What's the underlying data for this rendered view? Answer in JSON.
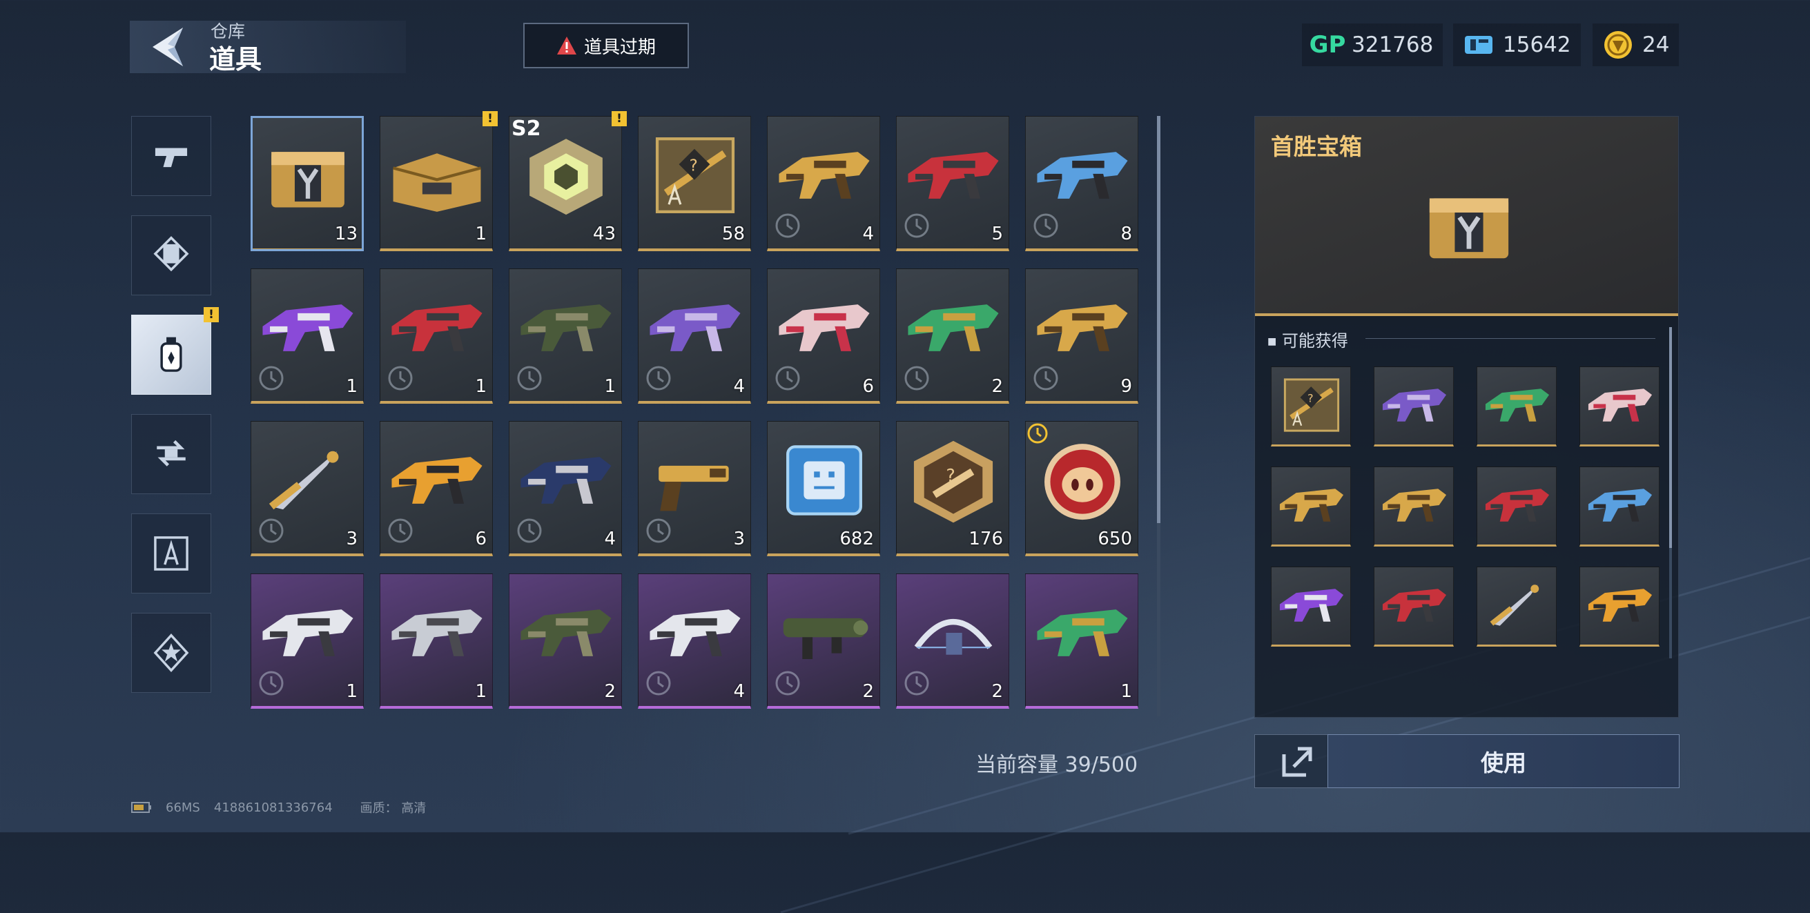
{
  "header": {
    "breadcrumb": "仓库",
    "title": "道具",
    "expire_button": "道具过期"
  },
  "currencies": [
    {
      "icon": "gp-icon",
      "label": "GP",
      "value": "321768",
      "color": "#36d9a0"
    },
    {
      "icon": "ticket-icon",
      "value": "15642",
      "color": "#58b6f0"
    },
    {
      "icon": "gold-coin-icon",
      "value": "24",
      "color": "#f2c232"
    }
  ],
  "categories": [
    {
      "name": "weapons",
      "icon": "pistol-icon",
      "active": false
    },
    {
      "name": "cards",
      "icon": "card-icon",
      "active": false
    },
    {
      "name": "items",
      "icon": "spray-can-icon",
      "active": true,
      "alert": "!"
    },
    {
      "name": "exchange",
      "icon": "exchange-icon",
      "active": false
    },
    {
      "name": "blueprints",
      "icon": "compass-icon",
      "active": false
    },
    {
      "name": "badges",
      "icon": "star-badge-icon",
      "active": false
    }
  ],
  "inventory": [
    {
      "art": "gold-chest",
      "count": "13",
      "selected": true
    },
    {
      "art": "gold-case",
      "count": "1",
      "alert": "!"
    },
    {
      "art": "hex-core",
      "count": "43",
      "season": "S2",
      "alert": "!"
    },
    {
      "art": "blueprint-card",
      "count": "58"
    },
    {
      "art": "rifle-gold-black",
      "count": "4",
      "timed": true
    },
    {
      "art": "rifle-red",
      "count": "5",
      "timed": true
    },
    {
      "art": "rifle-blue",
      "count": "8",
      "timed": true
    },
    {
      "art": "rifle-purple",
      "count": "1",
      "timed": true
    },
    {
      "art": "rifle-black-red",
      "count": "1",
      "timed": true
    },
    {
      "art": "rifle-camo",
      "count": "1",
      "timed": true
    },
    {
      "art": "rifle-violet",
      "count": "4",
      "timed": true
    },
    {
      "art": "rifle-pink",
      "count": "6",
      "timed": true
    },
    {
      "art": "rifle-green",
      "count": "2",
      "timed": true
    },
    {
      "art": "rifle-gold",
      "count": "9",
      "timed": true
    },
    {
      "art": "knife-gold",
      "count": "3",
      "timed": true
    },
    {
      "art": "rifle-orange",
      "count": "6",
      "timed": true
    },
    {
      "art": "rifle-navy",
      "count": "4",
      "timed": true
    },
    {
      "art": "pistol-gold",
      "count": "3",
      "timed": true
    },
    {
      "art": "chip-blue",
      "count": "682"
    },
    {
      "art": "hex-badge",
      "count": "176"
    },
    {
      "art": "piggy-token",
      "count": "650",
      "timer_badge": true
    },
    {
      "art": "rifle-white",
      "count": "1",
      "purple": true,
      "timed": true
    },
    {
      "art": "rifle-silver",
      "count": "1",
      "purple": true
    },
    {
      "art": "rifle-camo-dark",
      "count": "2",
      "purple": true
    },
    {
      "art": "rifle-white-red",
      "count": "4",
      "purple": true,
      "timed": true
    },
    {
      "art": "launcher-green",
      "count": "2",
      "purple": true,
      "timed": true
    },
    {
      "art": "bow-white",
      "count": "2",
      "purple": true,
      "timed": true
    },
    {
      "art": "rifle-green-camo",
      "count": "1",
      "purple": true
    }
  ],
  "capacity": "当前容量 39/500",
  "detail": {
    "title": "首胜宝箱",
    "image": "gold-chest",
    "rewards_label": "可能获得",
    "rewards": [
      "blueprint-card",
      "rifle-violet",
      "rifle-green",
      "rifle-pink",
      "rifle-gold",
      "rifle-gold-black",
      "rifle-red",
      "rifle-blue",
      "rifle-purple",
      "rifle-black-red",
      "knife-gold",
      "rifle-orange"
    ]
  },
  "use_button": "使用",
  "status_bar": {
    "ping": "66MS",
    "uid": "418861081336764",
    "quality": "画质： 高清"
  }
}
